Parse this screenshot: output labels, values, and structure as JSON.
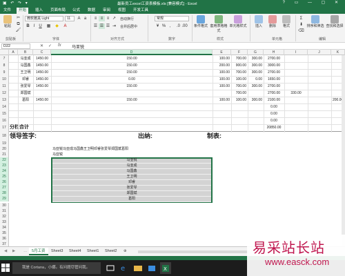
{
  "window": {
    "title": "最新员工excel工资表模板.xls [兼容模式] - Excel"
  },
  "ribbon_tabs": [
    "文件",
    "开始",
    "插入",
    "页面布局",
    "公式",
    "数据",
    "审阅",
    "视图",
    "开发工具"
  ],
  "ribbon": {
    "paste_label": "粘贴",
    "clipboard_group": "剪贴板",
    "font_name": "微软雅黑 Light",
    "font_size": "11",
    "font_group": "字体",
    "wrap_text": "自动换行",
    "merge_center": "合并后居中",
    "alignment_group": "对齐方式",
    "number_format": "常规",
    "number_group": "数字",
    "conditional_format": "条件格式",
    "table_format": "套用表格格式",
    "cell_styles": "单元格样式",
    "styles_group": "样式",
    "insert": "插入",
    "delete": "删除",
    "format": "格式",
    "cells_group": "单元格",
    "sort_filter": "排序和筛选",
    "find_select": "查找和选择",
    "editing_group": "编辑"
  },
  "formula_bar": {
    "name_box": "D22",
    "formula": "马亚锐"
  },
  "columns": [
    "A",
    "B",
    "C",
    "D",
    "E",
    "F",
    "G",
    "H",
    "I",
    "J",
    "K"
  ],
  "rows": [
    {
      "num": "7",
      "b": "马亚成",
      "c": "1450.00",
      "d": "150.00",
      "e": "100.00",
      "f": "700.00",
      "g": "300.00",
      "h": "2700.00"
    },
    {
      "num": "8",
      "b": "马国鑫",
      "c": "1450.00",
      "d": "150.00",
      "e": "200.00",
      "f": "900.00",
      "g": "300.00",
      "h": "3000.00"
    },
    {
      "num": "9",
      "b": "王卫明",
      "c": "1450.00",
      "d": "150.00",
      "e": "100.00",
      "f": "700.00",
      "g": "300.00",
      "h": "2700.00"
    },
    {
      "num": "10",
      "b": "邓睿",
      "c": "1450.00",
      "d": "0.00",
      "e": "100.00",
      "f": "100.00",
      "g": "0.00",
      "h": "1650.00"
    },
    {
      "num": "11",
      "b": "张爱琴",
      "c": "1450.00",
      "d": "150.00",
      "e": "100.00",
      "f": "700.00",
      "g": "300.00",
      "h": "2700.00"
    },
    {
      "num": "12",
      "b": "郑国斌",
      "c": "",
      "d": "",
      "e": "",
      "f": "700.00",
      "g": "",
      "h": "2700.00",
      "i": "330.00"
    },
    {
      "num": "13",
      "b": "葛阳",
      "c": "1450.00",
      "d": "150.00",
      "e": "100.00",
      "f": "100.00",
      "g": "300.00",
      "h": "2100.00",
      "k": "200.00"
    },
    {
      "num": "14",
      "h": "0.00"
    },
    {
      "num": "15",
      "h": "0.00"
    },
    {
      "num": "16",
      "h": "0.00"
    }
  ],
  "subtotal": {
    "num": "17",
    "label": "分栏合计",
    "value": "20850.00"
  },
  "signatures": {
    "num": "18",
    "leader": "领导签字:",
    "cashier": "出纳:",
    "maker": "制表:"
  },
  "row20_text": "马亚锐马亚成马国鑫王卫明邓睿张爱琴郑国斌葛阳",
  "row21_text": "马亚锐",
  "empty_rows": [
    "19",
    "20",
    "21"
  ],
  "list_rows": [
    {
      "num": "22",
      "name": "马亚锐"
    },
    {
      "num": "23",
      "name": "马亚成"
    },
    {
      "num": "24",
      "name": "马国鑫"
    },
    {
      "num": "25",
      "name": "王卫明"
    },
    {
      "num": "26",
      "name": "邓睿"
    },
    {
      "num": "27",
      "name": "张爱琴"
    },
    {
      "num": "28",
      "name": "郑国斌"
    },
    {
      "num": "29",
      "name": "葛阳"
    }
  ],
  "trailing_rows": [
    "30",
    "31",
    "32",
    "33",
    "34",
    "35",
    "36",
    "37"
  ],
  "sheet_tabs": [
    "5月工资",
    "Sheet3",
    "Sheet4",
    "Sheet1",
    "Sheet2"
  ],
  "taskbar": {
    "search_placeholder": "我是 Cortana，小娜。有问题尽管问我。"
  },
  "watermark": {
    "line1": "易采站长站",
    "line2": "www.easck.com"
  },
  "colors": {
    "excel_green": "#217346",
    "selection_fill": "#d3d3d3",
    "watermark": "#c0164e"
  }
}
